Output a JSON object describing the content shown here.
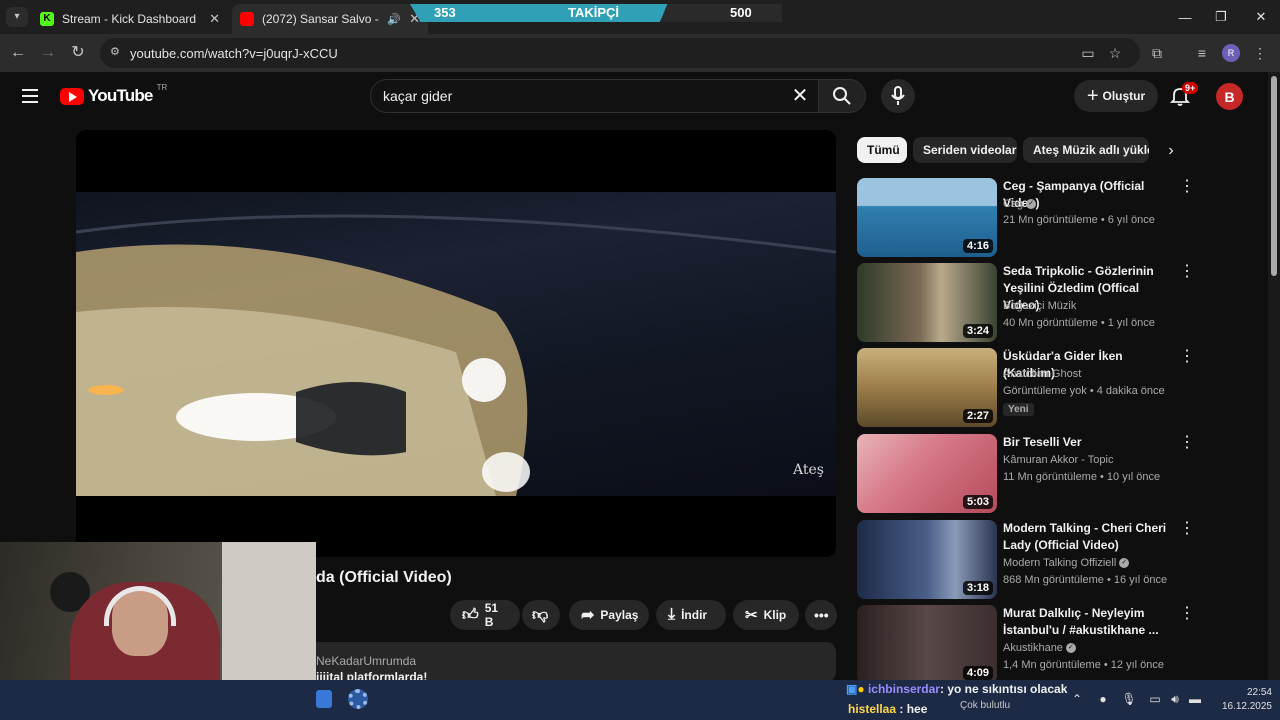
{
  "browser": {
    "tabs": [
      {
        "title": "Stream - Kick Dashboard",
        "favicon_color": "#53fc18"
      },
      {
        "title": "(2072) Sansar Salvo - Ne Ka",
        "favicon_color": "#ff0000"
      }
    ],
    "url": "youtube.com/watch?v=j0uqrJ-xCCU",
    "profile_initial": "R"
  },
  "stream_overlay": {
    "follower_count": "353",
    "label": "TAKİPÇİ",
    "goal": "500"
  },
  "youtube": {
    "logo_text": "YouTube",
    "country_code": "TR",
    "search_query": "kaçar gider",
    "create_label": "Oluştur",
    "notification_badge": "9+",
    "avatar_initial": "B"
  },
  "video": {
    "title_partial": "da (Official Video)",
    "watermark": "Ateş",
    "likes": "51 B",
    "share_label": "Paylaş",
    "download_label": "İndir",
    "clip_label": "Klip",
    "desc_user": "NeKadarUmrumda",
    "desc_text": "jijital platformlarda!"
  },
  "chips": [
    "Tümü",
    "Seriden videolar",
    "Ateş Müzik adlı yükle"
  ],
  "recommendations": [
    {
      "title": "Ceg - Şampanya (Official Video)",
      "channel": "Ceg",
      "verified": true,
      "meta": "21 Mn görüntüleme • 6 yıl önce",
      "duration": "4:16",
      "thumb_color": "#3f7fa8"
    },
    {
      "title": "Seda Tripkolic - Gözlerinin Yeşilini Özledim (Offical Video)",
      "channel": "Boğaziçi Müzik",
      "verified": false,
      "meta": "40 Mn görüntüleme • 1 yıl önce",
      "duration": "3:24",
      "thumb_color": "#4b5a3f"
    },
    {
      "title": "Üsküdar'a Gider İken (Katibim)",
      "channel": "Anatolian Ghost",
      "verified": false,
      "meta": "Görüntüleme yok • 4 dakika önce",
      "duration": "2:27",
      "badge": "Yeni",
      "thumb_color": "#8a7446"
    },
    {
      "title": "Bir Teselli Ver",
      "channel": "Kâmuran Akkor - Topic",
      "verified": false,
      "meta": "11 Mn görüntüleme • 10 yıl önce",
      "duration": "5:03",
      "thumb_color": "#c97a86"
    },
    {
      "title": "Modern Talking - Cheri Cheri Lady (Official Video)",
      "channel": "Modern Talking Offiziell",
      "verified": true,
      "meta": "868 Mn görüntüleme • 16 yıl önce",
      "duration": "3:18",
      "thumb_color": "#3a4a6a"
    },
    {
      "title": "Murat Dalkılıç - Neyleyim İstanbul'u / #akustikhane ...",
      "channel": "Akustikhane",
      "verified": true,
      "meta": "1,4 Mn görüntüleme • 12 yıl önce",
      "duration": "4:09",
      "thumb_color": "#3a3030"
    }
  ],
  "chat": [
    {
      "user": "ichbinserdar",
      "text": "yo ne sıkıntısı olacak"
    },
    {
      "user": "histellaa",
      "text": "hee"
    }
  ],
  "taskbar": {
    "weather": "Çok bulutlu",
    "time": "22:54",
    "date": "16.12.2025"
  }
}
